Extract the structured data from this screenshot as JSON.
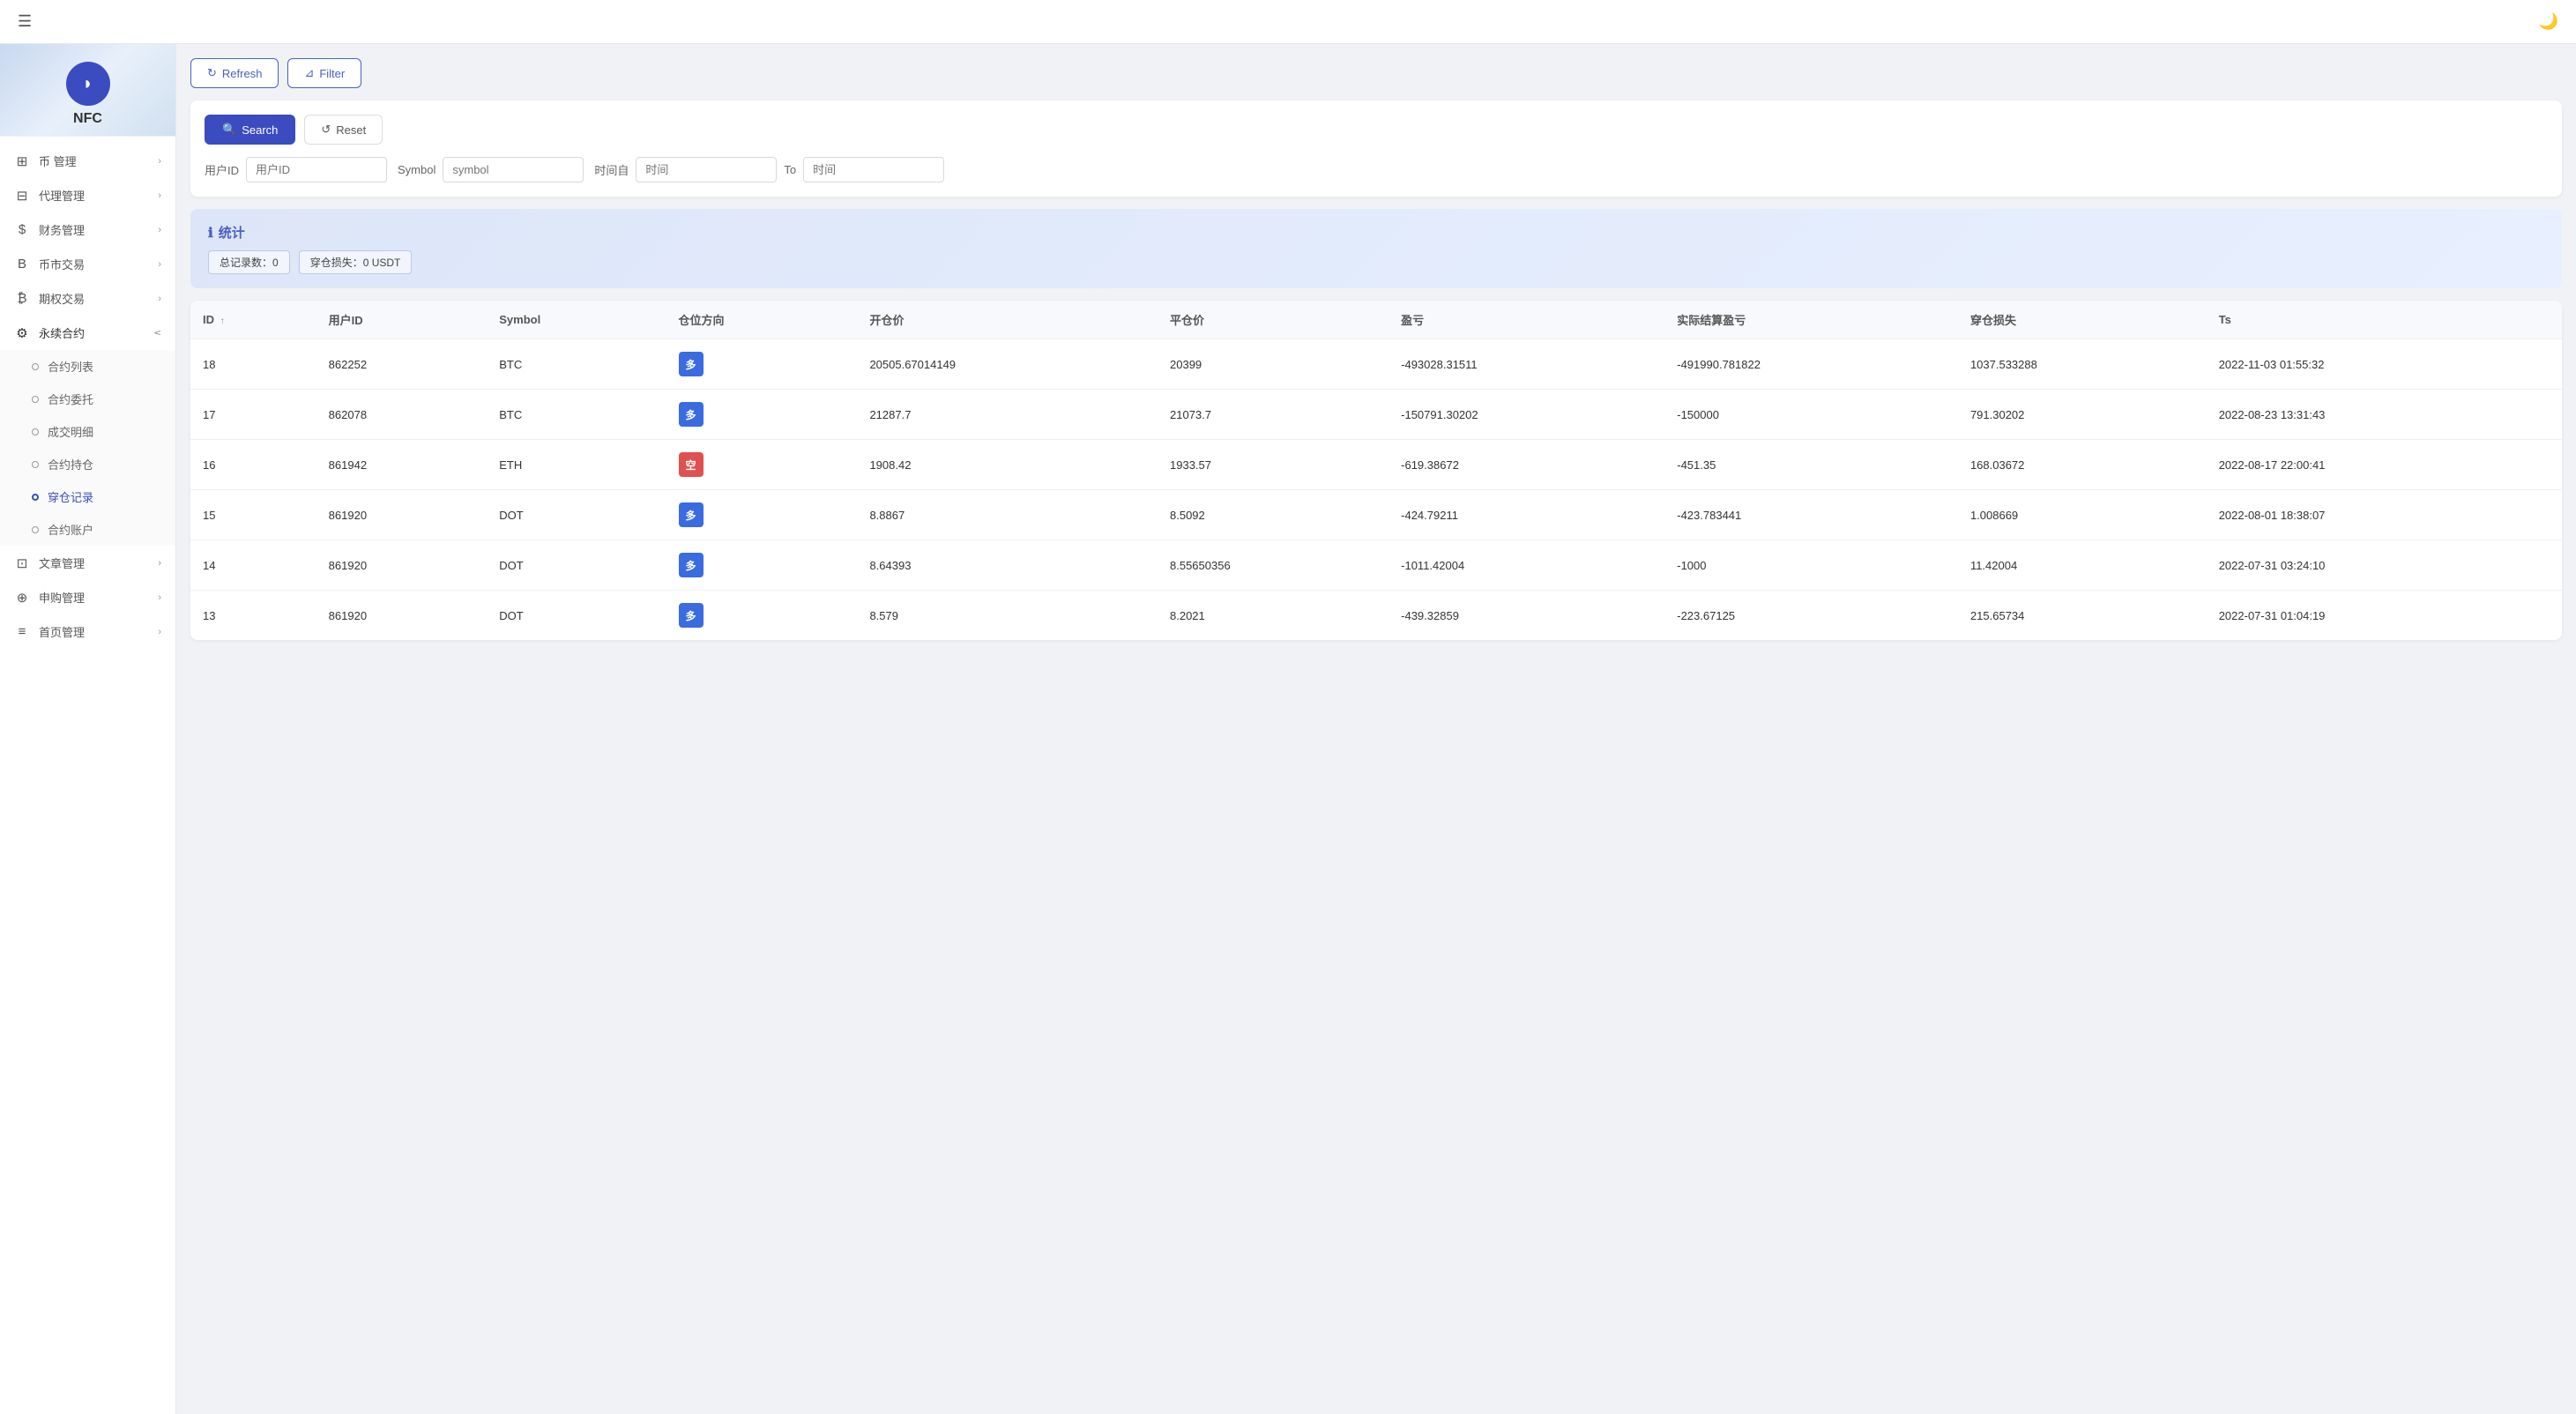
{
  "header": {
    "menu_icon": "☰",
    "theme_icon": "🌙"
  },
  "sidebar": {
    "logo_text": "NFC",
    "logo_symbol": "◗",
    "menu_items": [
      {
        "id": "currency-management",
        "icon": "⊞",
        "label": "币 管理",
        "has_arrow": true,
        "expanded": false
      },
      {
        "id": "agent-management",
        "icon": "⊟",
        "label": "代理管理",
        "has_arrow": true,
        "expanded": false
      },
      {
        "id": "finance-management",
        "icon": "$",
        "label": "财务管理",
        "has_arrow": true,
        "expanded": false
      },
      {
        "id": "coin-trading",
        "icon": "B",
        "label": "币市交易",
        "has_arrow": true,
        "expanded": false
      },
      {
        "id": "futures-trading",
        "icon": "₿",
        "label": "期权交易",
        "has_arrow": true,
        "expanded": false
      },
      {
        "id": "perpetual-contract",
        "icon": "⚙",
        "label": "永续合约",
        "has_arrow": true,
        "expanded": true,
        "sub_items": [
          {
            "id": "contract-list",
            "label": "合约列表",
            "active": false
          },
          {
            "id": "contract-order",
            "label": "合约委托",
            "active": false
          },
          {
            "id": "trade-detail",
            "label": "成交明细",
            "active": false
          },
          {
            "id": "contract-position",
            "label": "合约持仓",
            "active": false
          },
          {
            "id": "liquidation-record",
            "label": "穿仓记录",
            "active": true
          },
          {
            "id": "contract-account",
            "label": "合约账户",
            "active": false
          }
        ]
      },
      {
        "id": "article-management",
        "icon": "⊡",
        "label": "文章管理",
        "has_arrow": true,
        "expanded": false
      },
      {
        "id": "subscription-management",
        "icon": "⊕",
        "label": "申购管理",
        "has_arrow": true,
        "expanded": false
      },
      {
        "id": "homepage-management",
        "icon": "≡",
        "label": "首页管理",
        "has_arrow": true,
        "expanded": false
      }
    ]
  },
  "toolbar": {
    "refresh_label": "Refresh",
    "filter_label": "Filter"
  },
  "search": {
    "search_label": "Search",
    "reset_label": "Reset",
    "user_id_label": "用户ID",
    "user_id_placeholder": "用户ID",
    "symbol_label": "Symbol",
    "symbol_placeholder": "symbol",
    "time_from_label": "时间自",
    "time_from_placeholder": "时间",
    "time_to_label": "To",
    "time_to_placeholder": "时间"
  },
  "stats": {
    "title": "统计",
    "info_icon": "ℹ",
    "total_records_label": "总记录数：0",
    "loss_label": "穿仓损失：0 USDT"
  },
  "table": {
    "columns": [
      {
        "id": "id",
        "label": "ID",
        "sortable": true
      },
      {
        "id": "user_id",
        "label": "用户ID"
      },
      {
        "id": "symbol",
        "label": "Symbol"
      },
      {
        "id": "direction",
        "label": "仓位方向"
      },
      {
        "id": "open_price",
        "label": "开仓价"
      },
      {
        "id": "close_price",
        "label": "平仓价"
      },
      {
        "id": "pnl",
        "label": "盈亏"
      },
      {
        "id": "actual_pnl",
        "label": "实际结算盈亏"
      },
      {
        "id": "liquidation_loss",
        "label": "穿仓损失"
      },
      {
        "id": "ts",
        "label": "Ts"
      }
    ],
    "rows": [
      {
        "id": "18",
        "user_id": "862252",
        "symbol": "BTC",
        "direction": "多",
        "direction_type": "long",
        "open_price": "20505.67014149",
        "close_price": "20399",
        "pnl": "-493028.31511",
        "actual_pnl": "-491990.781822",
        "liquidation_loss": "1037.533288",
        "ts": "2022-11-03 01:55:32"
      },
      {
        "id": "17",
        "user_id": "862078",
        "symbol": "BTC",
        "direction": "多",
        "direction_type": "long",
        "open_price": "21287.7",
        "close_price": "21073.7",
        "pnl": "-150791.30202",
        "actual_pnl": "-150000",
        "liquidation_loss": "791.30202",
        "ts": "2022-08-23 13:31:43"
      },
      {
        "id": "16",
        "user_id": "861942",
        "symbol": "ETH",
        "direction": "空",
        "direction_type": "short",
        "open_price": "1908.42",
        "close_price": "1933.57",
        "pnl": "-619.38672",
        "actual_pnl": "-451.35",
        "liquidation_loss": "168.03672",
        "ts": "2022-08-17 22:00:41"
      },
      {
        "id": "15",
        "user_id": "861920",
        "symbol": "DOT",
        "direction": "多",
        "direction_type": "long",
        "open_price": "8.8867",
        "close_price": "8.5092",
        "pnl": "-424.79211",
        "actual_pnl": "-423.783441",
        "liquidation_loss": "1.008669",
        "ts": "2022-08-01 18:38:07"
      },
      {
        "id": "14",
        "user_id": "861920",
        "symbol": "DOT",
        "direction": "多",
        "direction_type": "long",
        "open_price": "8.64393",
        "close_price": "8.55650356",
        "pnl": "-1011.42004",
        "actual_pnl": "-1000",
        "liquidation_loss": "11.42004",
        "ts": "2022-07-31 03:24:10"
      },
      {
        "id": "13",
        "user_id": "861920",
        "symbol": "DOT",
        "direction": "多",
        "direction_type": "long",
        "open_price": "8.579",
        "close_price": "8.2021",
        "pnl": "-439.32859",
        "actual_pnl": "-223.67125",
        "liquidation_loss": "215.65734",
        "ts": "2022-07-31 01:04:19"
      }
    ]
  }
}
